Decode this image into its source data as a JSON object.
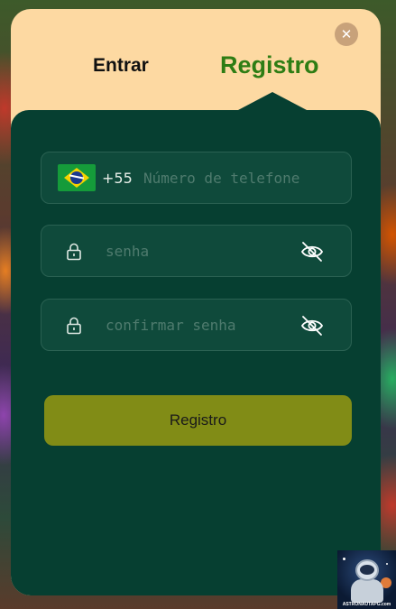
{
  "modal": {
    "close_icon": "close-icon",
    "tabs": {
      "login": "Entrar",
      "register": "Registro",
      "active": "register"
    }
  },
  "form": {
    "phone": {
      "flag_icon": "brazil-flag-icon",
      "country_code": "+55",
      "placeholder": "Número de telefone",
      "value": ""
    },
    "password": {
      "lock_icon": "lock-icon",
      "placeholder": "senha",
      "value": "",
      "toggle_icon": "eye-off-icon"
    },
    "confirm_password": {
      "lock_icon": "lock-icon",
      "placeholder": "confirmar senha",
      "value": "",
      "toggle_icon": "eye-off-icon"
    },
    "submit_label": "Registro"
  },
  "watermark": {
    "text": "ASTRONAUTAPG.com"
  },
  "colors": {
    "panel": "#063f31",
    "header": "#fdd9a2",
    "active_tab": "#2e7d14",
    "submit": "#818c16"
  }
}
